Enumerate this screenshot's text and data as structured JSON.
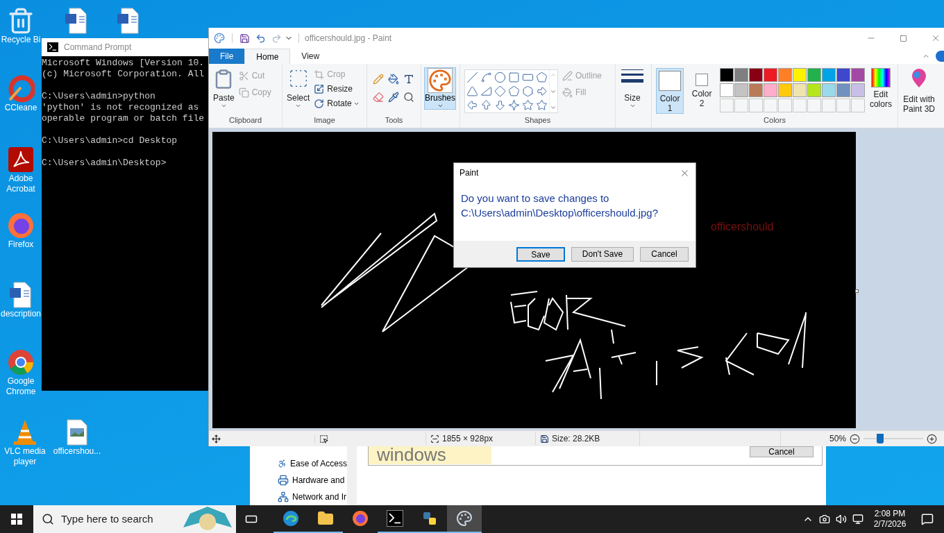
{
  "desktop_icons": [
    {
      "kind": "recycle",
      "label": [
        "Recycle Bi"
      ]
    },
    {
      "kind": "word"
    },
    {
      "kind": "word"
    },
    {
      "kind": "ccleaner",
      "label": [
        "CCleane"
      ]
    },
    {
      "kind": "acrobat",
      "label": [
        "Adobe",
        "Acrobat"
      ]
    },
    {
      "kind": "firefox",
      "label": [
        "Firefox"
      ]
    },
    {
      "kind": "word",
      "label": [
        "description"
      ]
    },
    {
      "kind": "chrome",
      "label": [
        "Google",
        "Chrome"
      ]
    },
    {
      "kind": "vlc",
      "label": [
        "VLC media",
        "player"
      ]
    },
    {
      "kind": "image",
      "label": [
        "officershou..."
      ]
    }
  ],
  "cmd_window": {
    "title": "Command Prompt",
    "blocks": [
      {
        "lines": [
          "Microsoft Windows [Version 10.",
          "(c) Microsoft Corporation. All"
        ]
      },
      {
        "lines": [
          "C:\\Users\\admin>python",
          "'python' is not recognized as",
          "operable program or batch file"
        ]
      },
      {
        "lines": [
          "C:\\Users\\admin>cd Desktop"
        ]
      },
      {
        "lines": [
          "C:\\Users\\admin\\Desktop>"
        ]
      }
    ]
  },
  "background_window": {
    "nav_items": [
      "Ease of Access",
      "Hardware and",
      "Network and Ir"
    ],
    "banner_text": "windows",
    "button": "Cancel"
  },
  "paint": {
    "title": "officershould.jpg - Paint",
    "tabs": [
      {
        "label": "File",
        "kind": "file",
        "selected": false
      },
      {
        "label": "Home",
        "kind": "tab",
        "selected": true
      },
      {
        "label": "View",
        "kind": "tab",
        "selected": false
      }
    ],
    "ribbon": {
      "clipboard": {
        "title": "Clipboard",
        "paste": "Paste",
        "cut": {
          "label": "Cut",
          "disabled": true
        },
        "copy": {
          "label": "Copy",
          "disabled": true
        }
      },
      "image": {
        "title": "Image",
        "select": "Select",
        "crop": {
          "label": "Crop",
          "disabled": true
        },
        "resize": {
          "label": "Resize",
          "disabled": false
        },
        "rotate": {
          "label": "Rotate",
          "disabled": false
        }
      },
      "tools": {
        "title": "Tools"
      },
      "brushes": {
        "label": "Brushes",
        "selected": true
      },
      "shapes": {
        "title": "Shapes",
        "outline": {
          "label": "Outline",
          "disabled": true
        },
        "fill": {
          "label": "Fill",
          "disabled": true
        }
      },
      "size": "Size",
      "colors": {
        "title": "Colors",
        "color1": {
          "label": "Color 1",
          "selected": true
        },
        "color2": {
          "label": "Color 2",
          "selected": false
        },
        "palette": [
          {
            "color": "#000000"
          },
          {
            "color": "#7f7f7f"
          },
          {
            "color": "#880015"
          },
          {
            "color": "#ed1c24"
          },
          {
            "color": "#ff7f27"
          },
          {
            "color": "#fff200"
          },
          {
            "color": "#22b14c"
          },
          {
            "color": "#00a2e8"
          },
          {
            "color": "#3f48cc"
          },
          {
            "color": "#a349a4"
          },
          {
            "color": "#ffffff"
          },
          {
            "color": "#c3c3c3"
          },
          {
            "color": "#b97a57"
          },
          {
            "color": "#ffaec9"
          },
          {
            "color": "#ffc90e"
          },
          {
            "color": "#efe4b0"
          },
          {
            "color": "#b5e61d"
          },
          {
            "color": "#99d9ea"
          },
          {
            "color": "#7092be"
          },
          {
            "color": "#c8bfe7"
          }
        ],
        "edit_colors": "Edit colors"
      },
      "paint3d": "Edit with Paint 3D"
    },
    "canvas": {
      "text": "officershould"
    },
    "status": {
      "dimensions": "1855 × 928px",
      "size": "Size: 28.2KB",
      "zoom": "50%",
      "zoom_slider": {
        "level": 0.25
      }
    }
  },
  "dialog": {
    "title": "Paint",
    "message": "Do you want to save changes to C:\\Users\\admin\\Desktop\\officershould.jpg?",
    "buttons": [
      {
        "label": "Save",
        "default": true
      },
      {
        "label": "Don't Save",
        "default": false
      },
      {
        "label": "Cancel",
        "default": false
      }
    ]
  },
  "taskbar": {
    "search_placeholder": "Type here to search",
    "apps": [
      {
        "kind": "edge",
        "running": true,
        "selected": false
      },
      {
        "kind": "explorer",
        "running": true,
        "selected": false
      },
      {
        "kind": "firefox",
        "running": false,
        "selected": false
      },
      {
        "kind": "cmd",
        "running": true,
        "selected": false
      },
      {
        "kind": "python",
        "running": true,
        "selected": false
      },
      {
        "kind": "paint",
        "running": true,
        "selected": true
      }
    ],
    "time": "2:08 PM",
    "date": "2/7/2026"
  }
}
